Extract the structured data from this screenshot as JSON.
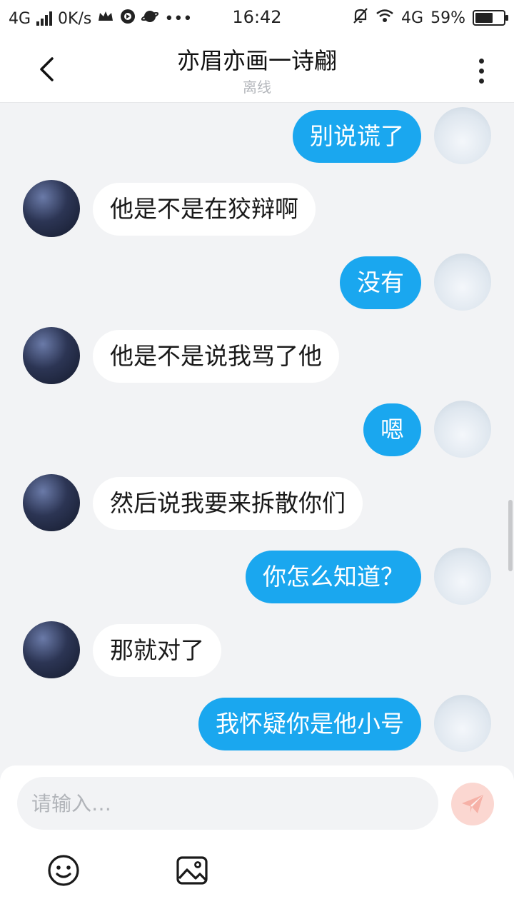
{
  "status_bar": {
    "network": "4G",
    "speed": "0K/s",
    "more": "•••",
    "time": "16:42",
    "network_right": "4G",
    "battery": "59%"
  },
  "header": {
    "title": "亦眉亦画一诗翩",
    "subtitle": "离线"
  },
  "messages": [
    {
      "side": "right",
      "text": "别说谎了"
    },
    {
      "side": "left",
      "text": "他是不是在狡辩啊"
    },
    {
      "side": "right",
      "text": "没有"
    },
    {
      "side": "left",
      "text": "他是不是说我骂了他"
    },
    {
      "side": "right",
      "text": "嗯"
    },
    {
      "side": "left",
      "text": "然后说我要来拆散你们"
    },
    {
      "side": "right",
      "text": "你怎么知道？"
    },
    {
      "side": "left",
      "text": "那就对了"
    },
    {
      "side": "right",
      "text": "我怀疑你是他小号"
    }
  ],
  "input": {
    "placeholder": "请输入…"
  },
  "colors": {
    "accent": "#1aa7ef",
    "send_disabled": "#fbd7d1"
  },
  "icons": [
    "back-icon",
    "more-icon",
    "send-icon",
    "emoji-icon",
    "image-icon"
  ]
}
